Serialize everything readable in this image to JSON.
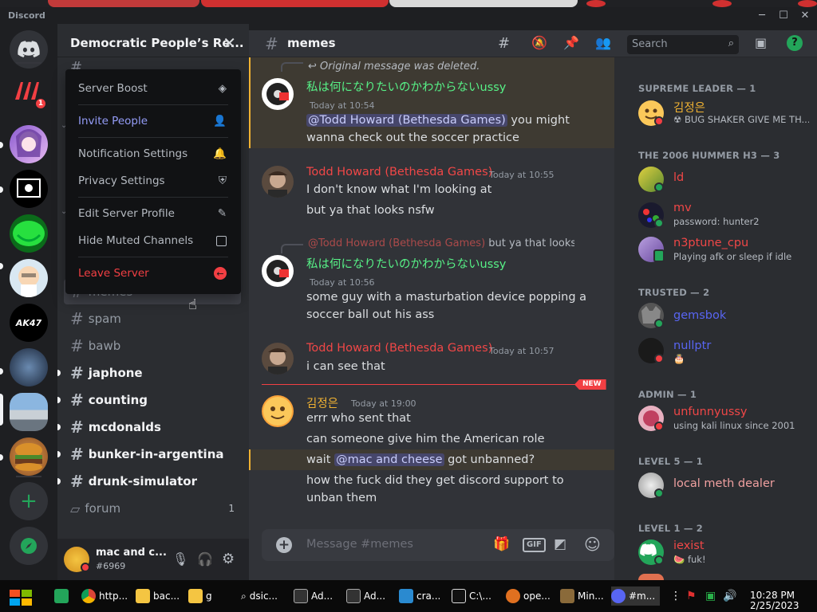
{
  "window": {
    "title": "Discord"
  },
  "server": {
    "name": "Democratic People’s Re...",
    "close": "✕"
  },
  "menu": {
    "items": [
      {
        "label": "Server Boost",
        "icon": "boost-icon"
      },
      {
        "label": "Invite People",
        "icon": "add-person-icon"
      },
      {
        "label": "Notification Settings",
        "icon": "bell-icon"
      },
      {
        "label": "Privacy Settings",
        "icon": "shield-icon"
      },
      {
        "label": "Edit Server Profile",
        "icon": "pencil-icon"
      },
      {
        "label": "Hide Muted Channels",
        "icon": "checkbox-icon"
      },
      {
        "label": "Leave Server",
        "icon": "leave-icon"
      }
    ]
  },
  "channels": [
    {
      "name": "memes",
      "unread": false
    },
    {
      "name": "spam",
      "unread": false
    },
    {
      "name": "bawb",
      "unread": false
    },
    {
      "name": "japhone",
      "unread": true
    },
    {
      "name": "counting",
      "unread": true
    },
    {
      "name": "mcdonalds",
      "unread": true
    },
    {
      "name": "bunker-in-argentina",
      "unread": true
    },
    {
      "name": "drunk-simulator",
      "unread": true
    },
    {
      "name": "forum",
      "unread": false,
      "count": "1"
    }
  ],
  "rail": {
    "badge": "1",
    "server_labels": {
      "ak47": "AK47"
    }
  },
  "user": {
    "name": "mac and c...",
    "tag": "#6969"
  },
  "chat": {
    "channel": "memes",
    "search_placeholder": "Search",
    "input_placeholder": "Message #memes",
    "gif": "GIF",
    "new_label": "NEW",
    "deleted_reply": "Original message was deleted.",
    "messages": [
      {
        "author": "私は何になりたいのかわからないussy",
        "time": "Today at 10:54",
        "lines": [
          "@Todd Howard (Bethesda Games)",
          " you might",
          "wanna check out the soccer practice"
        ]
      },
      {
        "author": "Todd Howard (Bethesda Games)",
        "time": "Today at 10:55",
        "lines": [
          "I don't know what I'm looking at",
          "but ya that looks nsfw"
        ]
      },
      {
        "reply_to": "@Todd Howard (Bethesda Games)",
        "reply_text": "but ya that looks r",
        "author": "私は何になりたいのかわからないussy",
        "time": "Today at 10:56",
        "lines": [
          "some guy with a masturbation device popping a",
          "soccer ball out his ass"
        ]
      },
      {
        "author": "Todd Howard (Bethesda Games)",
        "time": "Today at 10:57",
        "lines": [
          "i can see that"
        ]
      },
      {
        "author": "김정은",
        "time": "Today at 19:00",
        "lines": [
          "errr who sent that",
          "can someone give him the American role",
          "wait ",
          "@mac and cheese",
          " got unbanned?",
          "how the fuck did they get discord support to",
          "unban them"
        ]
      }
    ]
  },
  "members": {
    "groups": [
      {
        "title": "SUPREME LEADER — 1",
        "members": [
          {
            "name": "김정은",
            "status": "☢ BUG SHAKER GIVE ME TH..."
          }
        ]
      },
      {
        "title": "THE 2006 HUMMER H3 — 3",
        "members": [
          {
            "name": "ld",
            "status": ""
          },
          {
            "name": "mv",
            "status": "password: hunter2"
          },
          {
            "name": "n3ptune_cpu",
            "status": "Playing afk or sleep if idle"
          }
        ]
      },
      {
        "title": "TRUSTED — 2",
        "members": [
          {
            "name": "gemsbok",
            "status": ""
          },
          {
            "name": "nullptr",
            "status": "🎂"
          }
        ]
      },
      {
        "title": "ADMIN — 1",
        "members": [
          {
            "name": "unfunnyussy",
            "status": "using kali linux since 2001"
          }
        ]
      },
      {
        "title": "LEVEL 5 — 1",
        "members": [
          {
            "name": "local meth dealer",
            "status": ""
          }
        ]
      },
      {
        "title": "LEVEL 1 — 2",
        "members": [
          {
            "name": "iexist",
            "status": "🍉 fuk!"
          }
        ]
      }
    ]
  },
  "taskbar": {
    "items": [
      "http...",
      "bac...",
      "g",
      "dsic...",
      "Ad...",
      "Ad...",
      "cra...",
      "C:\\...",
      "ope...",
      "Min...",
      "#m..."
    ],
    "time": "10:28 PM",
    "date": "2/25/2023"
  },
  "colors": {
    "blurple": "#5865f2",
    "red": "#f23f43",
    "green": "#23a55a",
    "todd": "#f04747",
    "ussy": "#57f287",
    "kim": "#f0b232"
  }
}
